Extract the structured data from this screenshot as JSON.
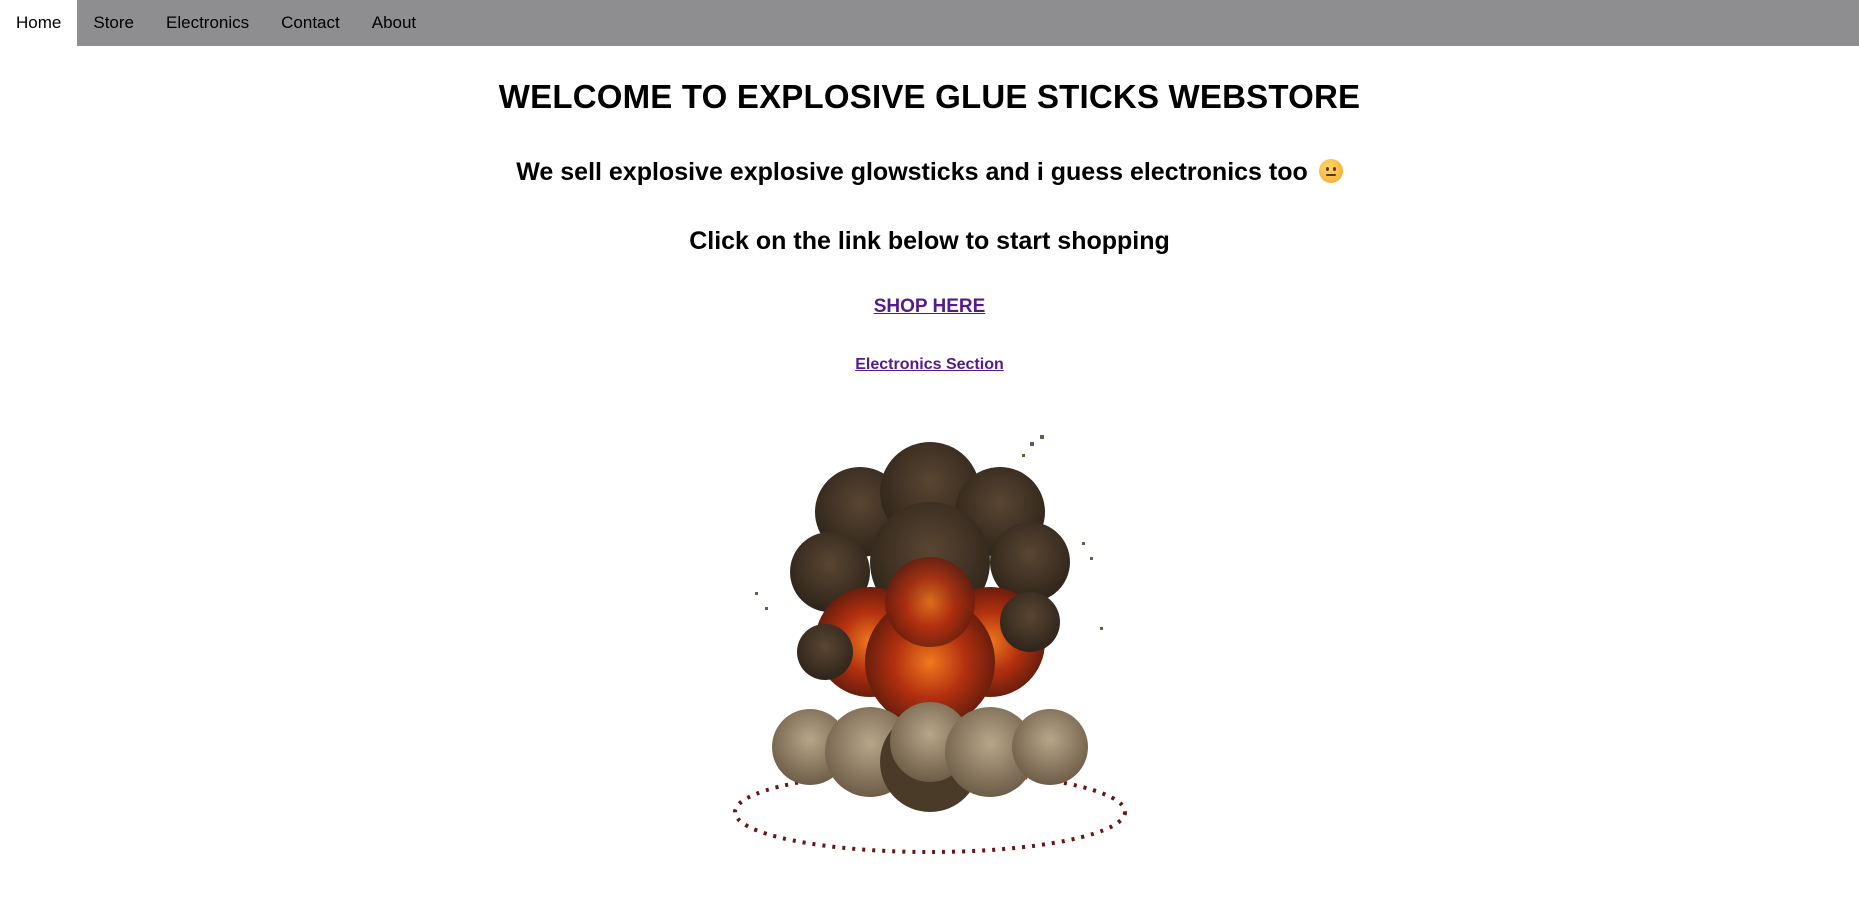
{
  "nav": {
    "items": [
      {
        "label": "Home",
        "active": true
      },
      {
        "label": "Store",
        "active": false
      },
      {
        "label": "Electronics",
        "active": false
      },
      {
        "label": "Contact",
        "active": false
      },
      {
        "label": "About",
        "active": false
      }
    ]
  },
  "main": {
    "title": "WELCOME TO EXPLOSIVE GLUE STICKS WEBSTORE",
    "subtitle": "We sell explosive explosive glowsticks and i guess electronics too",
    "subtitle_emoji": "neutral-face-emoji",
    "cta_text": "Click on the link below to start shopping",
    "shop_link": "SHOP HERE",
    "electronics_link": "Electronics Section",
    "image": "pixel-explosion-image"
  },
  "colors": {
    "navbar_bg": "#8e8d8f",
    "active_tab_bg": "#ffffff",
    "visited_link": "#551a8b"
  }
}
